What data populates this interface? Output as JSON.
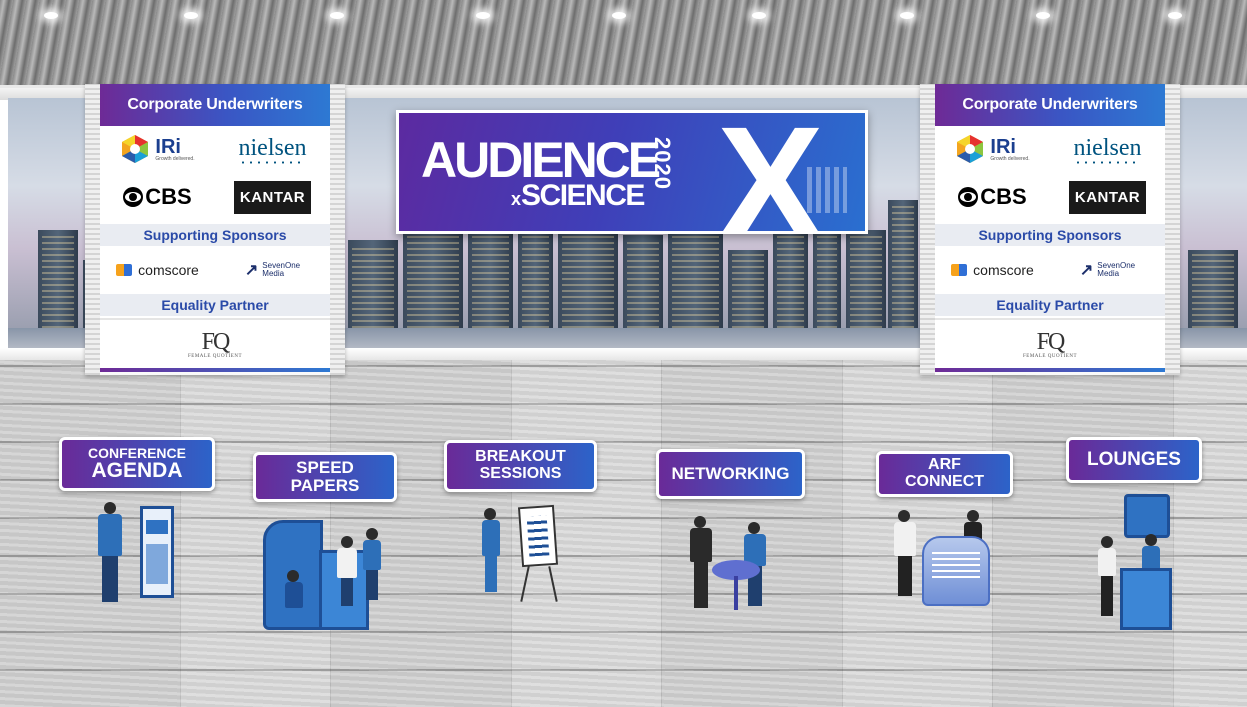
{
  "banner": {
    "title_line1": "AUDIENCE",
    "title_prefix": "x",
    "title_line2": "SCIENCE",
    "year": "2020",
    "big_letter": "X"
  },
  "sponsor_board": {
    "heading": "Corporate Underwriters",
    "underwriters": {
      "iri_name": "IRi",
      "iri_tagline": "Growth delivered.",
      "nielsen": "nielsen",
      "cbs": "CBS",
      "kantar": "KANTAR"
    },
    "supporting_label": "Supporting Sponsors",
    "supporting": {
      "comscore": "comscore",
      "sevenone_line1": "SevenOne",
      "sevenone_line2": "Media"
    },
    "equality_label": "Equality Partner",
    "equality": {
      "fq_prefix": "the",
      "fq_mark": "FQ",
      "fq_sub": "FEMALE QUOTIENT"
    }
  },
  "nav": [
    {
      "id": "conference-agenda",
      "line1": "CONFERENCE",
      "line2": "AGENDA"
    },
    {
      "id": "speed-papers",
      "line1": "SPEED",
      "line2": "PAPERS"
    },
    {
      "id": "breakout-sessions",
      "line1": "BREAKOUT",
      "line2": "SESSIONS"
    },
    {
      "id": "networking",
      "line1": "NETWORKING",
      "line2": ""
    },
    {
      "id": "arf-connect",
      "line1": "ARF",
      "line2": "CONNECT"
    },
    {
      "id": "lounges",
      "line1": "LOUNGES",
      "line2": ""
    }
  ],
  "colors": {
    "sign_gradient_start": "#6a2a98",
    "sign_gradient_end": "#2c63c9",
    "sponsor_label_text": "#2a4aa8",
    "booth_blue": "#2f72c2"
  }
}
